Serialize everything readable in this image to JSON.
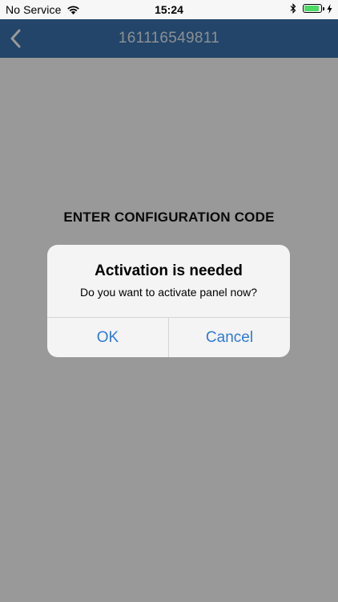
{
  "status_bar": {
    "carrier": "No Service",
    "time": "15:24",
    "battery_level": 0.9,
    "icons": [
      "wifi-icon",
      "bluetooth-icon",
      "battery-icon",
      "charging-bolt-icon"
    ]
  },
  "nav": {
    "title": "161116549811",
    "back_icon": "chevron-left-icon",
    "background": "#3a74b0"
  },
  "content": {
    "heading": "ENTER CONFIGURATION CODE"
  },
  "alert": {
    "title": "Activation is needed",
    "message": "Do you want to activate panel now?",
    "ok_label": "OK",
    "cancel_label": "Cancel",
    "button_color": "#2f7ad6"
  }
}
